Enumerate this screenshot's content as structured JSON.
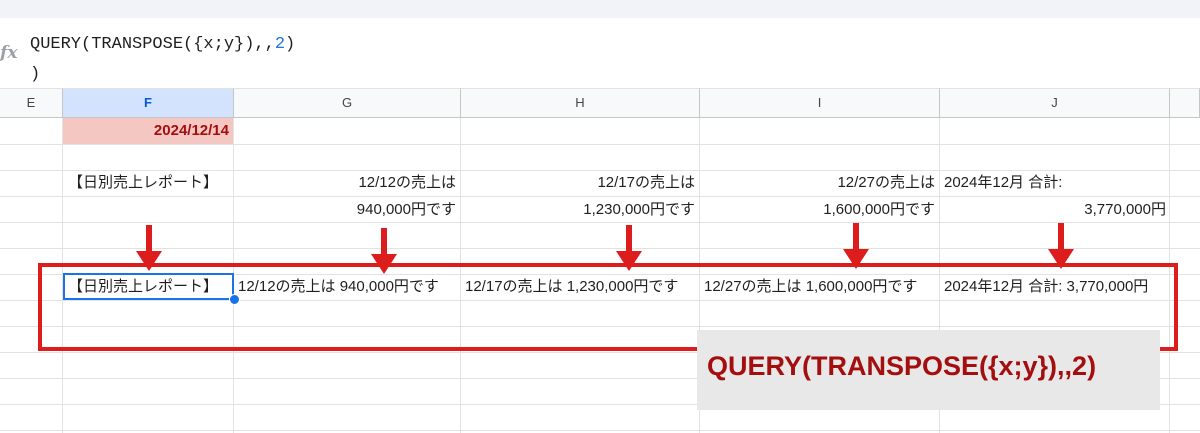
{
  "formula_bar": {
    "icon": "fx-icon",
    "line1_prefix": "QUERY(TRANSPOSE({x;y}),,",
    "line1_number": "2",
    "line1_suffix": ")",
    "line2": ")"
  },
  "columns": [
    "E",
    "F",
    "G",
    "H",
    "I",
    "J"
  ],
  "selected_column": "F",
  "cells": {
    "date": "2024/12/14",
    "row3": {
      "f": "【日別売上レポート】",
      "g": "12/12の売上は",
      "h": "12/17の売上は",
      "i": "12/27の売上は",
      "j": "2024年12月 合計:"
    },
    "row4": {
      "g": "940,000円です",
      "h": "1,230,000円です",
      "i": "1,600,000円です",
      "j": "3,770,000円"
    },
    "row6": {
      "f": "【日別売上レポート】",
      "g": "12/12の売上は 940,000円です",
      "h": "12/17の売上は 1,230,000円です",
      "i": "12/27の売上は 1,600,000円です",
      "j": "2024年12月 合計: 3,770,000円"
    }
  },
  "annotation": {
    "label": "QUERY(TRANSPOSE({x;y}),,2)",
    "accent_color": "#dd1c1c",
    "label_color": "#a50e0e"
  },
  "colors": {
    "selected_header": "#d3e3fd",
    "date_fill": "#f4c7c3",
    "active_border": "#1a73e8"
  }
}
